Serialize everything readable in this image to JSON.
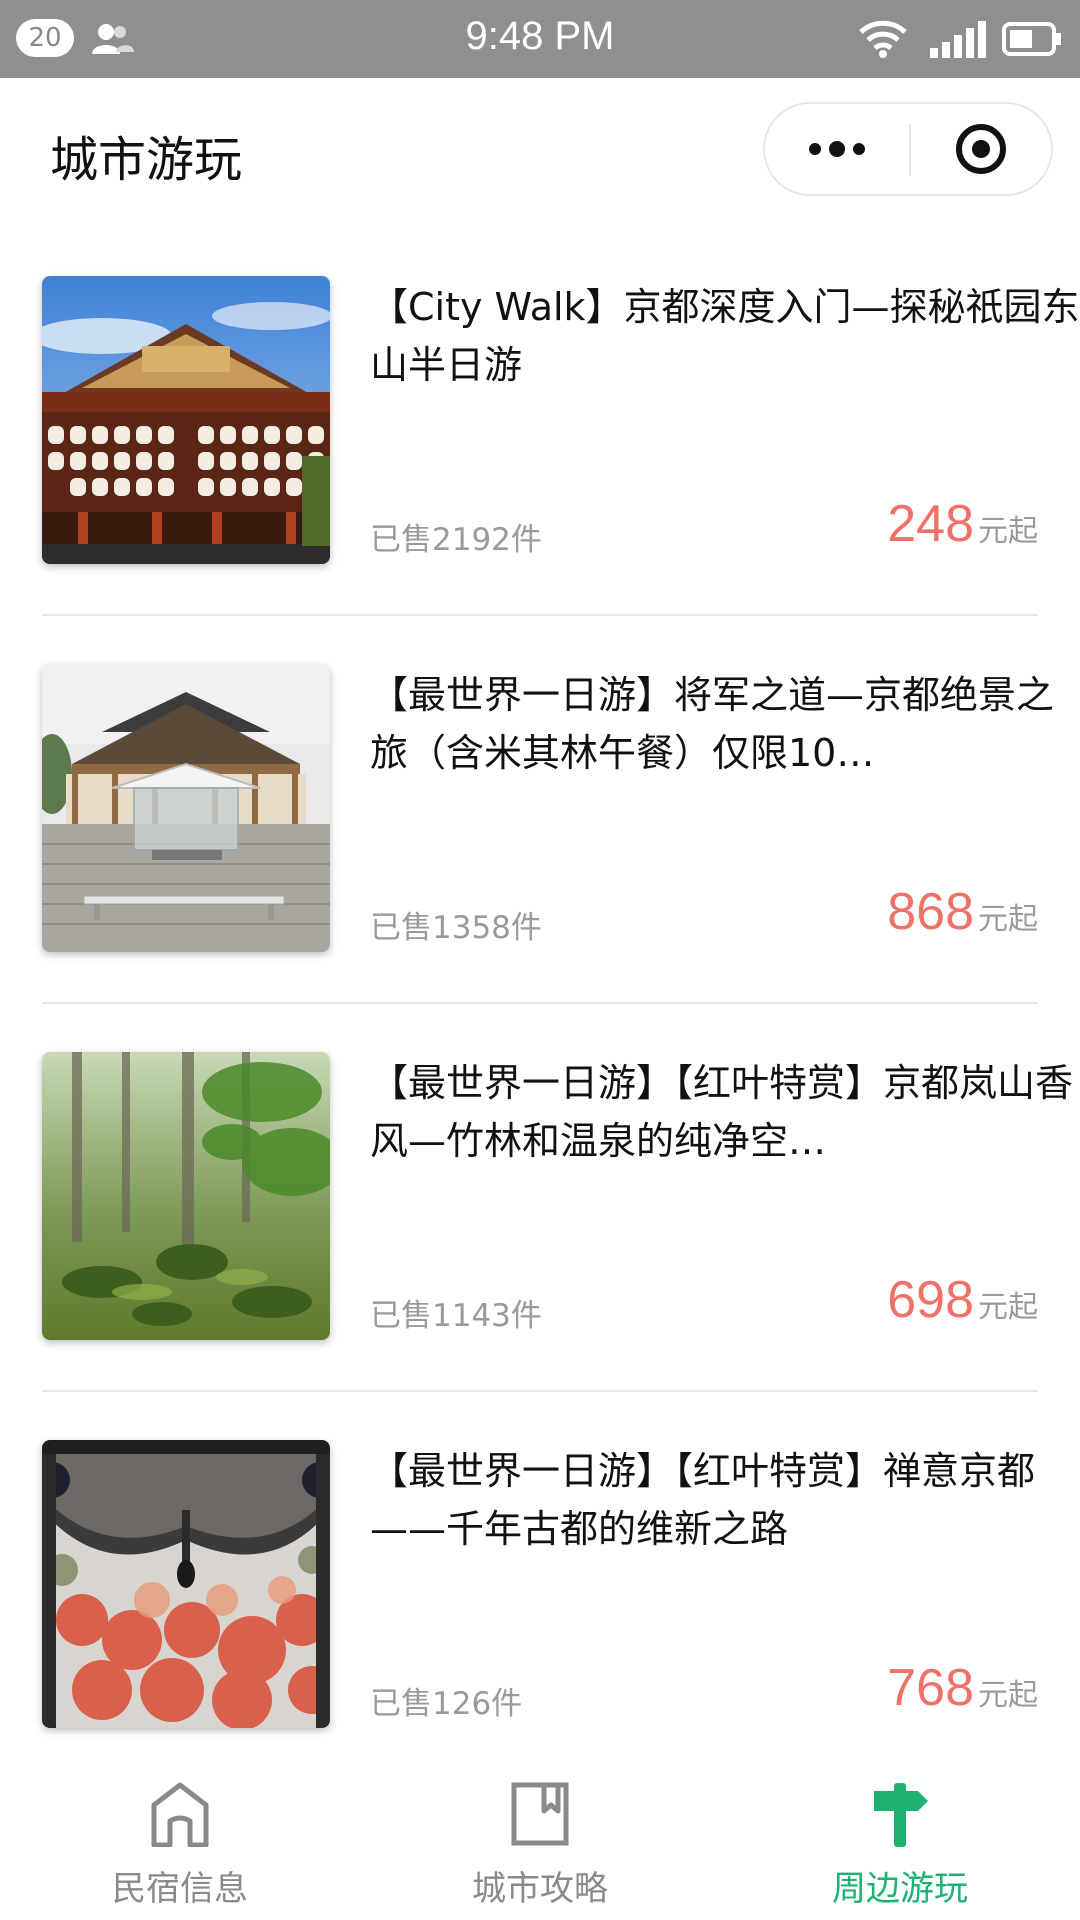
{
  "status_bar": {
    "notification_count": "20",
    "time": "9:48 PM",
    "icons": [
      "contacts-icon",
      "wifi-icon",
      "signal-icon",
      "battery-icon"
    ]
  },
  "nav": {
    "title": "城市游玩",
    "more_icon": "more-dots-icon",
    "close_icon": "target-close-icon"
  },
  "items": [
    {
      "title": "【City Walk】京都深度入门—探秘祇园东山半日游",
      "sold": "已售2192件",
      "price": "248",
      "price_unit": "元起",
      "image": "kyoto-temple-lanterns"
    },
    {
      "title": "【最世界一日游】将军之道—京都绝景之旅（含米其林午餐）仅限10…",
      "sold": "已售1358件",
      "price": "868",
      "price_unit": "元起",
      "image": "kyoto-shrine-glass-pavilion"
    },
    {
      "title": "【最世界一日游】【红叶特赏】京都岚山香风—竹林和温泉的纯净空…",
      "sold": "已售1143件",
      "price": "698",
      "price_unit": "元起",
      "image": "moss-garden-maple"
    },
    {
      "title": "【最世界一日游】【红叶特赏】禅意京都——千年古都的维新之路",
      "sold": "已售126件",
      "price": "768",
      "price_unit": "元起",
      "image": "curtain-autumn-maple"
    }
  ],
  "tabs": [
    {
      "label": "民宿信息",
      "icon": "home-icon",
      "active": false
    },
    {
      "label": "城市攻略",
      "icon": "bookmark-icon",
      "active": false
    },
    {
      "label": "周边游玩",
      "icon": "signpost-icon",
      "active": true
    }
  ],
  "colors": {
    "accent": "#1db172",
    "price": "#f07167",
    "status_bar": "#8f8f8f"
  }
}
